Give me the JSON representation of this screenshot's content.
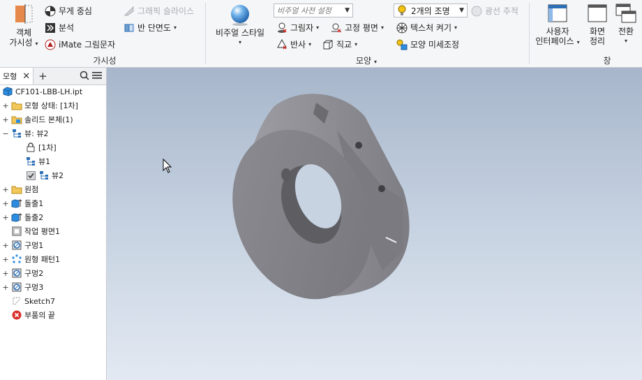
{
  "ribbon": {
    "visibility_group": {
      "object_visibility_line1": "객체",
      "object_visibility_line2": "가시성",
      "center_of_gravity": "무게 중심",
      "analysis": "분석",
      "imate_glyph": "iMate 그림문자",
      "graphics_slice": "그래픽 슬라이스",
      "half_section": "반 단면도",
      "label": "가시성"
    },
    "appearance_group": {
      "visual_style": "비주얼 스타일",
      "visual_style_preset_placeholder": "비주얼 사전 설정",
      "shadows": "그림자",
      "reflections": "반사",
      "ground_plane": "고정 평면",
      "orthographic": "직교",
      "lighting": "2개의 조명",
      "ray_tracing": "광선 추적",
      "texture_on": "텍스처 켜기",
      "appearance_tune": "모양 미세조정",
      "label": "모양"
    },
    "window_group": {
      "user_interface_line1": "사용자",
      "user_interface_line2": "인터페이스",
      "arrange_line1": "화면",
      "arrange_line2": "정리",
      "switch": "전환",
      "label": "창"
    }
  },
  "browser": {
    "tab_label": "모형",
    "items": [
      {
        "label": "CF101-LBB-LH.ipt",
        "icon": "part-icon"
      },
      {
        "label": "모형 상태: [1차]",
        "icon": "folder-icon"
      },
      {
        "label": "솔리드 본체(1)",
        "icon": "solid-bodies-icon"
      },
      {
        "label": "뷰: 뷰2",
        "icon": "view-rep-icon"
      },
      {
        "label": "[1차]",
        "icon": "lock-icon"
      },
      {
        "label": "뷰1",
        "icon": "view-icon"
      },
      {
        "label": "뷰2",
        "icon": "view-icon"
      },
      {
        "label": "원점",
        "icon": "folder-icon"
      },
      {
        "label": "돌출1",
        "icon": "extrude-icon"
      },
      {
        "label": "돌출2",
        "icon": "extrude-icon"
      },
      {
        "label": "작업 평면1",
        "icon": "work-plane-icon"
      },
      {
        "label": "구멍1",
        "icon": "hole-icon"
      },
      {
        "label": "원형 패턴1",
        "icon": "circular-pattern-icon"
      },
      {
        "label": "구멍2",
        "icon": "hole-icon"
      },
      {
        "label": "구멍3",
        "icon": "hole-icon"
      },
      {
        "label": "Sketch7",
        "icon": "sketch-icon"
      },
      {
        "label": "부품의 끝",
        "icon": "end-of-part-icon"
      }
    ]
  },
  "colors": {
    "accent_orange": "#e06c2c",
    "accent_blue": "#2c6fb7",
    "error_red": "#d9302b"
  }
}
